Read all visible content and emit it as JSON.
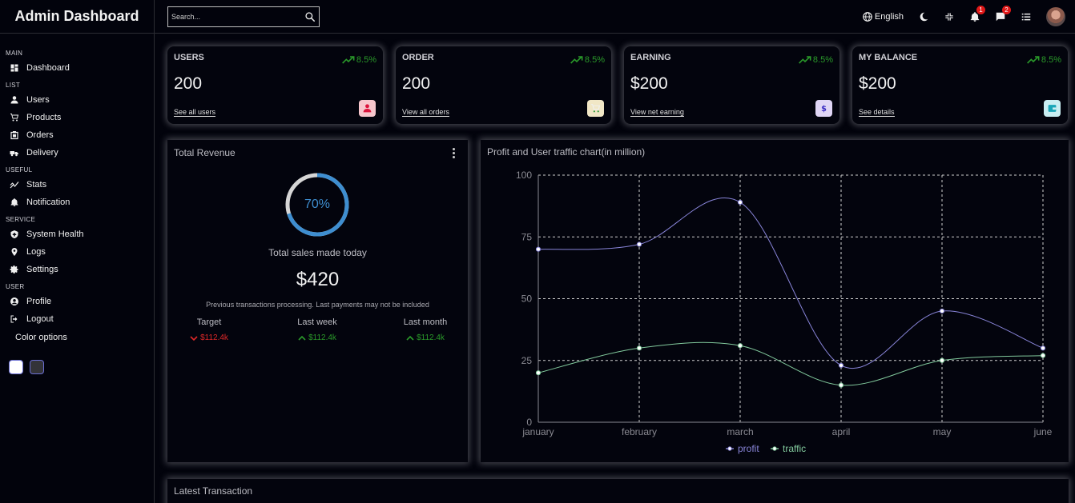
{
  "app_title": "Admin Dashboard",
  "sidebar": {
    "sections": [
      {
        "title": "MAIN",
        "items": [
          {
            "label": "Dashboard",
            "icon": "dashboard-icon"
          }
        ]
      },
      {
        "title": "LIST",
        "items": [
          {
            "label": "Users",
            "icon": "user-icon"
          },
          {
            "label": "Products",
            "icon": "cart-icon"
          },
          {
            "label": "Orders",
            "icon": "orders-icon"
          },
          {
            "label": "Delivery",
            "icon": "delivery-icon"
          }
        ]
      },
      {
        "title": "USEFUL",
        "items": [
          {
            "label": "Stats",
            "icon": "stats-icon"
          },
          {
            "label": "Notification",
            "icon": "bell-icon"
          }
        ]
      },
      {
        "title": "SERVICE",
        "items": [
          {
            "label": "System Health",
            "icon": "shield-icon"
          },
          {
            "label": "Logs",
            "icon": "logs-icon"
          },
          {
            "label": "Settings",
            "icon": "gear-icon"
          }
        ]
      },
      {
        "title": "USER",
        "items": [
          {
            "label": "Profile",
            "icon": "profile-icon"
          },
          {
            "label": "Logout",
            "icon": "logout-icon"
          }
        ]
      }
    ],
    "color_options_label": "Color options"
  },
  "topbar": {
    "search_placeholder": "Search...",
    "language": "English",
    "notifications_count": "1",
    "messages_count": "2"
  },
  "widgets": [
    {
      "title": "USERS",
      "value": "200",
      "link": "See all users",
      "pct": "8.5%",
      "icon": "user-icon",
      "icon_color": "#dc143c",
      "icon_bg": "#f7c6cc"
    },
    {
      "title": "ORDER",
      "value": "200",
      "link": "View all orders",
      "pct": "8.5%",
      "icon": "cart-icon",
      "icon_color": "#2e9c3a",
      "icon_bg": "#f1e7c6"
    },
    {
      "title": "EARNING",
      "value": "$200",
      "link": "View net earning",
      "pct": "8.5%",
      "icon": "dollar-icon",
      "icon_color": "#3c2fc2",
      "icon_bg": "#e0d6f5"
    },
    {
      "title": "MY BALANCE",
      "value": "$200",
      "link": "See details",
      "pct": "8.5%",
      "icon": "wallet-icon",
      "icon_color": "#1aa6b8",
      "icon_bg": "#c9eef2"
    }
  ],
  "revenue": {
    "title": "Total Revenue",
    "progress_label": "70%",
    "progress": 0.7,
    "subtitle": "Total sales made today",
    "amount": "$420",
    "note": "Previous transactions processing. Last payments may not be included",
    "columns": [
      {
        "title": "Target",
        "value": "$112.4k",
        "trend": "down"
      },
      {
        "title": "Last week",
        "value": "$112.4k",
        "trend": "up"
      },
      {
        "title": "Last month",
        "value": "$112.4k",
        "trend": "up"
      }
    ]
  },
  "traffic_title": "Profit and User traffic chart(in million)",
  "latest_title": "Latest Transaction",
  "colors": {
    "profit": "#8884d8",
    "traffic": "#82ca9d",
    "ring": "#3e8ed0"
  },
  "chart_data": {
    "type": "line",
    "categories": [
      "january",
      "february",
      "march",
      "april",
      "may",
      "june"
    ],
    "series": [
      {
        "name": "profit",
        "values": [
          70,
          72,
          89,
          23,
          45,
          30
        ]
      },
      {
        "name": "traffic",
        "values": [
          20,
          30,
          31,
          15,
          25,
          27
        ]
      }
    ],
    "yticks": [
      "0",
      "25",
      "50",
      "75",
      "100"
    ],
    "ylim": [
      0,
      100
    ],
    "grid": true,
    "legend": "bottom-center"
  }
}
